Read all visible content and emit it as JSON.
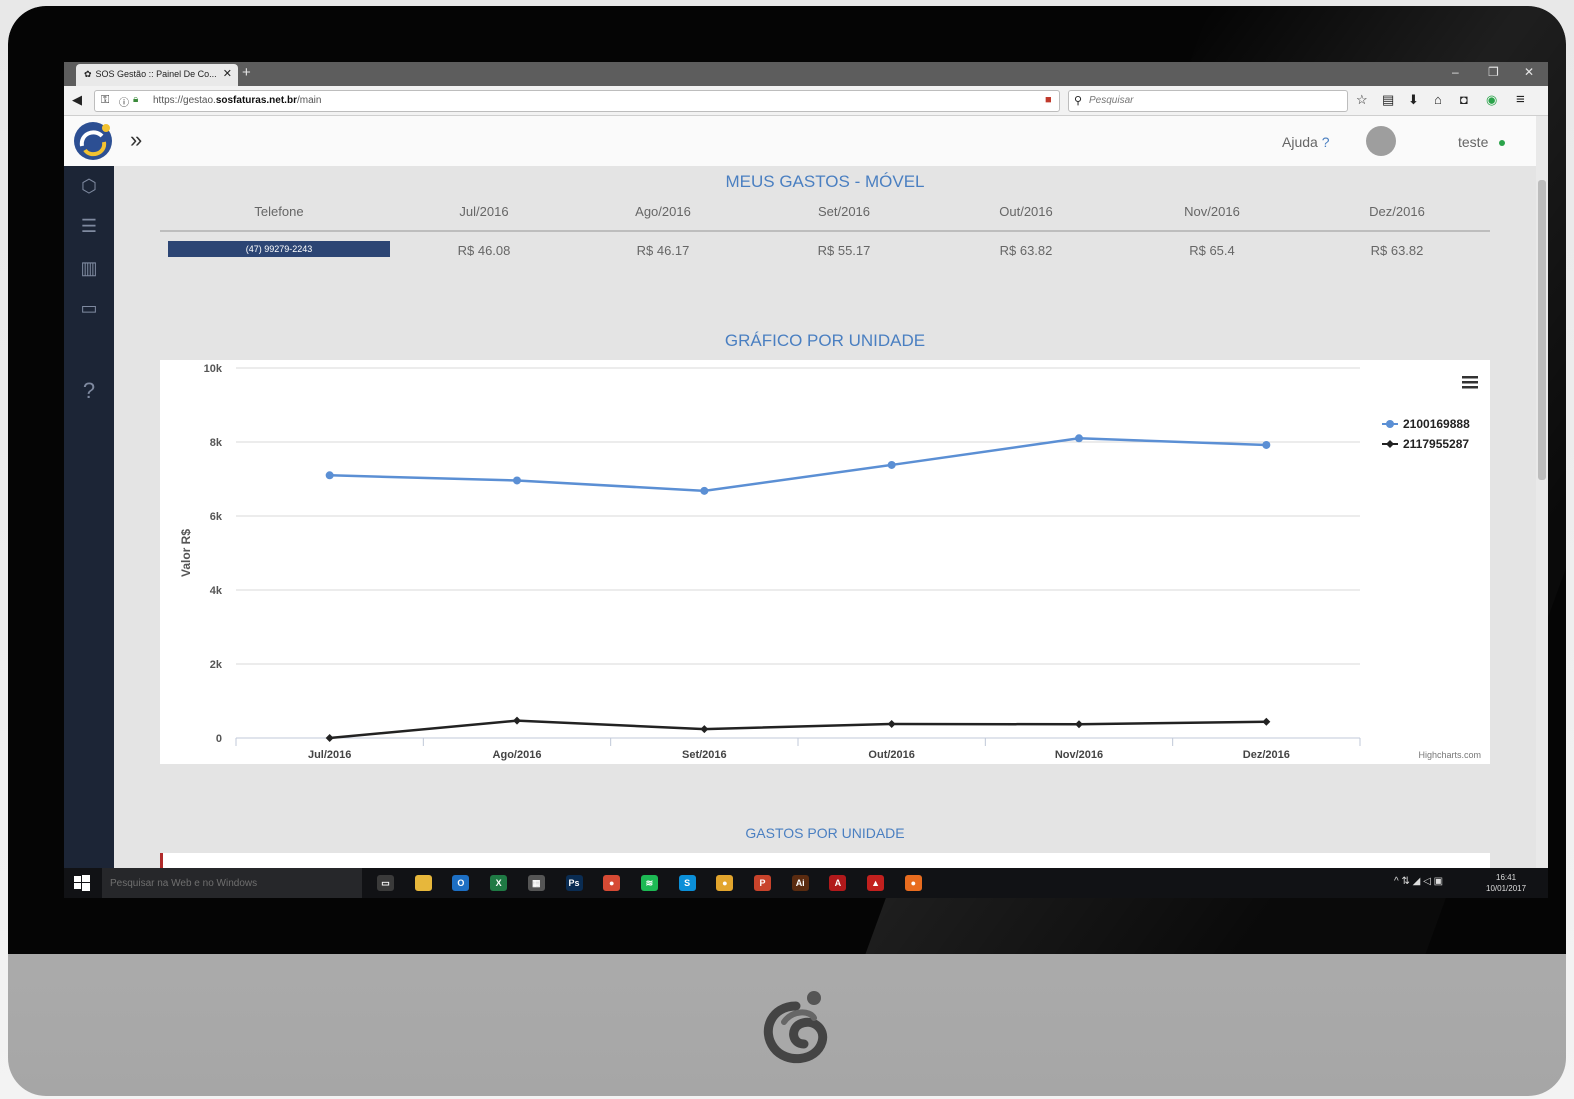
{
  "browser": {
    "tab_title": "SOS Gestão :: Painel De Co...",
    "url_prefix": "https://gestao.",
    "url_domain": "sosfaturas.net.br",
    "url_path": "/main",
    "search_placeholder": "Pesquisar"
  },
  "topbar": {
    "help_label": "Ajuda",
    "help_mark": "?",
    "user_name": "teste",
    "online_color": "#2aa34a"
  },
  "sidebar": {
    "items": [
      {
        "icon": "box-icon"
      },
      {
        "icon": "list-icon"
      },
      {
        "icon": "bar-chart-icon"
      },
      {
        "icon": "card-icon"
      },
      {
        "icon": "help-icon",
        "glyph": "?"
      }
    ]
  },
  "spend_table": {
    "title": "MEUS GASTOS - MÓVEL",
    "columns": [
      "Telefone",
      "Jul/2016",
      "Ago/2016",
      "Set/2016",
      "Out/2016",
      "Nov/2016",
      "Dez/2016"
    ],
    "rows": [
      {
        "phone": "(47) 99279-2243",
        "values": [
          "R$ 46.08",
          "R$ 46.17",
          "R$ 55.17",
          "R$ 63.82",
          "R$ 65.4",
          "R$ 63.82"
        ]
      }
    ]
  },
  "chart_section_title": "GRÁFICO POR UNIDADE",
  "chart_data": {
    "type": "line",
    "categories": [
      "Jul/2016",
      "Ago/2016",
      "Set/2016",
      "Out/2016",
      "Nov/2016",
      "Dez/2016"
    ],
    "ylabel": "Valor R$",
    "ylim": [
      0,
      10000
    ],
    "y_ticks": [
      "0",
      "2k",
      "4k",
      "6k",
      "8k",
      "10k"
    ],
    "grid": true,
    "legend_placement": "top-right",
    "credit": "Highcharts.com",
    "series": [
      {
        "name": "2100169888",
        "color": "#5b8fd4",
        "values": [
          7100,
          6960,
          6680,
          7380,
          8100,
          7920
        ]
      },
      {
        "name": "2117955287",
        "color": "#222222",
        "values": [
          0,
          470,
          240,
          380,
          370,
          440
        ]
      }
    ]
  },
  "bottom_section_title": "GASTOS POR UNIDADE",
  "taskbar": {
    "search_placeholder": "Pesquisar na Web e no Windows",
    "time": "16:41",
    "date": "10/01/2017",
    "apps": [
      {
        "name": "task-view-icon",
        "color": "#3a3a3a",
        "glyph": "▭"
      },
      {
        "name": "file-explorer-icon",
        "color": "#e7b73b",
        "glyph": ""
      },
      {
        "name": "outlook-icon",
        "color": "#1d6fc4",
        "glyph": "O"
      },
      {
        "name": "excel-icon",
        "color": "#1f7a44",
        "glyph": "X"
      },
      {
        "name": "calculator-icon",
        "color": "#555555",
        "glyph": "▦"
      },
      {
        "name": "photoshop-icon",
        "color": "#0a2c52",
        "glyph": "Ps"
      },
      {
        "name": "chrome-icon",
        "color": "#d64a34",
        "glyph": "●"
      },
      {
        "name": "spotify-icon",
        "color": "#1db954",
        "glyph": "≋"
      },
      {
        "name": "skype-icon",
        "color": "#0b8fd8",
        "glyph": "S"
      },
      {
        "name": "chrome-alt-icon",
        "color": "#e2a52d",
        "glyph": "●"
      },
      {
        "name": "powerpoint-icon",
        "color": "#c8432b",
        "glyph": "P"
      },
      {
        "name": "illustrator-icon",
        "color": "#5a2b10",
        "glyph": "Ai"
      },
      {
        "name": "acrobat-icon",
        "color": "#b1191b",
        "glyph": "A"
      },
      {
        "name": "pdf-icon",
        "color": "#c2201e",
        "glyph": "▲"
      },
      {
        "name": "firefox-icon",
        "color": "#e86c1f",
        "glyph": "●"
      }
    ]
  }
}
